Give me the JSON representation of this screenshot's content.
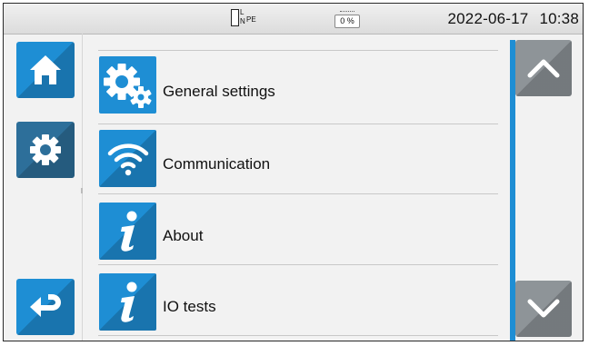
{
  "status": {
    "plug_labels": {
      "l": "L",
      "n": "N",
      "pe": "PE"
    },
    "battery": "0 %",
    "date": "2022-06-17",
    "time": "10:38"
  },
  "nav": {
    "home": "home-icon",
    "settings": "gear-icon",
    "back": "back-arrow-icon"
  },
  "menu": {
    "items": [
      {
        "label": "General settings",
        "icon": "gears-icon"
      },
      {
        "label": "Communication",
        "icon": "wifi-icon"
      },
      {
        "label": "About",
        "icon": "info-icon"
      },
      {
        "label": "IO tests",
        "icon": "info-icon"
      }
    ]
  },
  "colors": {
    "accent": "#1e8ed4",
    "nav_active": "#2d6f9a",
    "scroll_button": "#8e9498"
  }
}
